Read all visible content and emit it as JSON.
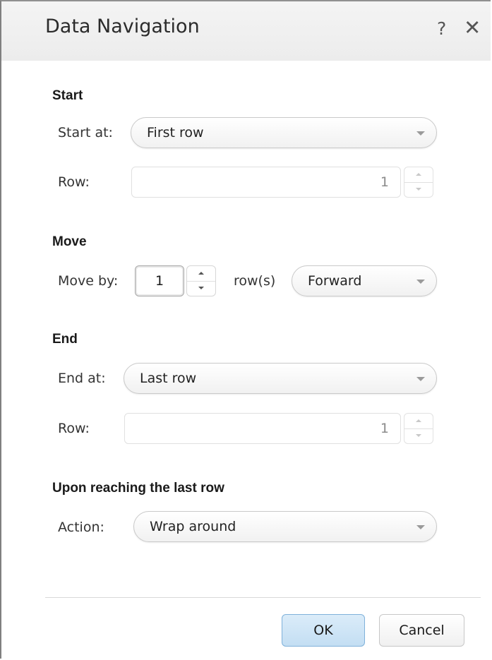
{
  "dialog": {
    "title": "Data Navigation",
    "help_label": "?",
    "close_label": "✕"
  },
  "start": {
    "heading": "Start",
    "start_at_label": "Start at:",
    "start_at_value": "First row",
    "row_label": "Row:",
    "row_value": "1"
  },
  "move": {
    "heading": "Move",
    "move_by_label": "Move by:",
    "move_by_value": "1",
    "unit_label": "row(s)",
    "direction_value": "Forward"
  },
  "end": {
    "heading": "End",
    "end_at_label": "End at:",
    "end_at_value": "Last row",
    "row_label": "Row:",
    "row_value": "1"
  },
  "upon_last": {
    "heading": "Upon reaching the last row",
    "action_label": "Action:",
    "action_value": "Wrap around"
  },
  "buttons": {
    "ok": "OK",
    "cancel": "Cancel"
  },
  "colors": {
    "ok_button_border": "#7fb1da",
    "ok_button_fill": "#c3def3",
    "titlebar_bg": "#efefef"
  },
  "icons": {
    "help": "help-icon",
    "close": "close-icon",
    "dropdown": "chevron-down-icon",
    "spin_up": "arrow-up-icon",
    "spin_down": "arrow-down-icon"
  }
}
